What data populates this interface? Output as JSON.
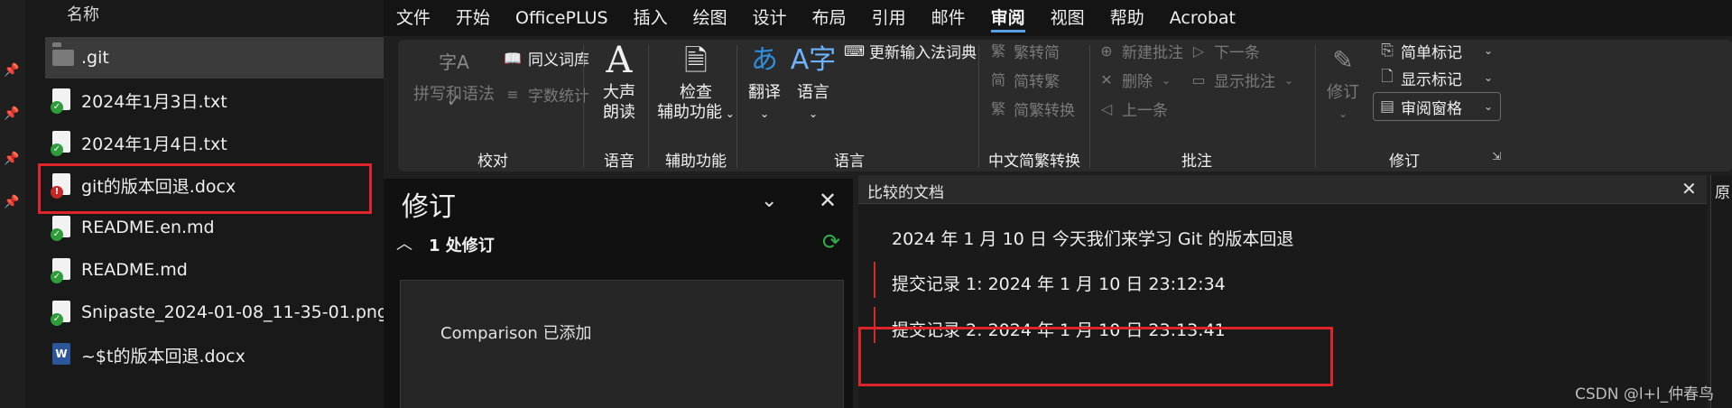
{
  "explorer": {
    "column_header": "名称",
    "files": [
      {
        "name": ".git",
        "icon": "folder-icon"
      },
      {
        "name": "2024年1月3日.txt",
        "icon": "text-file-synced-icon"
      },
      {
        "name": "2024年1月4日.txt",
        "icon": "text-file-synced-icon"
      },
      {
        "name": "git的版本回退.docx",
        "icon": "doc-file-modified-icon"
      },
      {
        "name": "README.en.md",
        "icon": "text-file-synced-icon"
      },
      {
        "name": "README.md",
        "icon": "text-file-synced-icon"
      },
      {
        "name": "Snipaste_2024-01-08_11-35-01.png",
        "icon": "image-file-synced-icon"
      },
      {
        "name": "~$t的版本回退.docx",
        "icon": "word-file-icon"
      }
    ],
    "status_glyphs": {
      "synced": "✓",
      "modified": "!",
      "word": "W"
    }
  },
  "menu": {
    "tabs": [
      "文件",
      "开始",
      "OfficePLUS",
      "插入",
      "绘图",
      "设计",
      "布局",
      "引用",
      "邮件",
      "审阅",
      "视图",
      "帮助",
      "Acrobat"
    ],
    "active": "审阅"
  },
  "ribbon": {
    "proofing": {
      "group": "校对",
      "spelling": "拼写和语法",
      "thesaurus": "同义词库",
      "word_count": "字数统计",
      "spelling_icon_text": "字A"
    },
    "speech": {
      "group": "语音",
      "read_aloud_line1": "大声",
      "read_aloud_line2": "朗读"
    },
    "accessibility": {
      "group": "辅助功能",
      "check_line1": "检查",
      "check_line2": "辅助功能"
    },
    "language": {
      "group": "语言",
      "translate": "翻译",
      "language": "语言",
      "update_ime": "更新输入法词典",
      "translate_icon_text": "あ",
      "language_icon_text": "A字"
    },
    "chinese": {
      "group": "中文简繁转换",
      "to_traditional": "繁转简",
      "to_simplified": "简转繁",
      "convert": "简繁转换",
      "glyph_traditional": "繁",
      "glyph_simplified": "简"
    },
    "comments": {
      "group": "批注",
      "new": "新建批注",
      "delete": "删除",
      "previous": "上一条",
      "next": "下一条",
      "show": "显示批注"
    },
    "tracking": {
      "group": "修订",
      "track_changes": "修订",
      "display_for_review": "简单标记",
      "show_markup": "显示标记",
      "reviewing_pane": "审阅窗格"
    }
  },
  "revisions_pane": {
    "title": "修订",
    "count": "1 处修订",
    "item": "Comparison  已添加"
  },
  "compared_doc": {
    "title": "比较的文档",
    "lines": [
      "2024 年 1 月 10 日  今天我们来学习 Git 的版本回退",
      "提交记录 1:    2024 年 1 月 10 日 23:12:34",
      "提交记录 2:    2024 年 1 月 10 日 23:13:41"
    ]
  },
  "right_pane_label": "原",
  "watermark": "CSDN @l+l_仲春鸟",
  "colors": {
    "highlight": "#e0242c",
    "revision_bar": "#d42a2a",
    "accent": "#5aa0e6",
    "sync_green": "#2e9c3a"
  }
}
